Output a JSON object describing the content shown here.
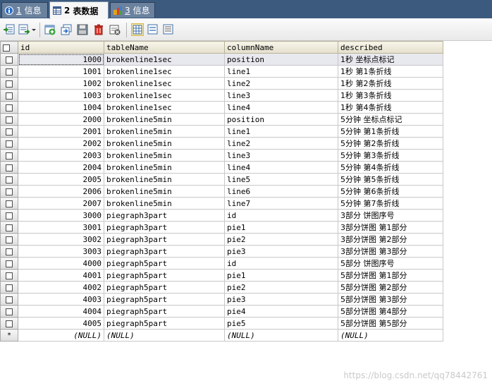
{
  "tabs": [
    {
      "num": "1",
      "label": "信息",
      "active": false,
      "icon": "info-icon"
    },
    {
      "num": "2",
      "label": "表数据",
      "active": true,
      "icon": "table-icon"
    },
    {
      "num": "3",
      "label": "信息",
      "active": false,
      "icon": "info-grid-icon"
    }
  ],
  "toolbar": {
    "items": [
      "export-icon",
      "import-dropdown-icon",
      "insert-row-icon",
      "duplicate-row-icon",
      "save-icon",
      "delete-icon",
      "refresh-icon",
      "grid-view-icon",
      "form-view-icon",
      "text-view-icon"
    ]
  },
  "grid": {
    "columns": [
      "id",
      "tableName",
      "columnName",
      "described"
    ],
    "null_label": "(NULL)",
    "new_row_marker": "*",
    "rows": [
      [
        "1000",
        "brokenline1sec",
        "position",
        "1秒 坐标点标记"
      ],
      [
        "1001",
        "brokenline1sec",
        "line1",
        "1秒 第1条折线"
      ],
      [
        "1002",
        "brokenline1sec",
        "line2",
        "1秒 第2条折线"
      ],
      [
        "1003",
        "brokenline1sec",
        "line3",
        "1秒 第3条折线"
      ],
      [
        "1004",
        "brokenline1sec",
        "line4",
        "1秒 第4条折线"
      ],
      [
        "2000",
        "brokenline5min",
        "position",
        "5分钟 坐标点标记"
      ],
      [
        "2001",
        "brokenline5min",
        "line1",
        "5分钟 第1条折线"
      ],
      [
        "2002",
        "brokenline5min",
        "line2",
        "5分钟 第2条折线"
      ],
      [
        "2003",
        "brokenline5min",
        "line3",
        "5分钟 第3条折线"
      ],
      [
        "2004",
        "brokenline5min",
        "line4",
        "5分钟 第4条折线"
      ],
      [
        "2005",
        "brokenline5min",
        "line5",
        "5分钟 第5条折线"
      ],
      [
        "2006",
        "brokenline5min",
        "line6",
        "5分钟 第6条折线"
      ],
      [
        "2007",
        "brokenline5min",
        "line7",
        "5分钟 第7条折线"
      ],
      [
        "3000",
        "piegraph3part",
        "id",
        "3部分 饼图序号"
      ],
      [
        "3001",
        "piegraph3part",
        "pie1",
        "3部分饼图 第1部分"
      ],
      [
        "3002",
        "piegraph3part",
        "pie2",
        "3部分饼图 第2部分"
      ],
      [
        "3003",
        "piegraph3part",
        "pie3",
        "3部分饼图 第3部分"
      ],
      [
        "4000",
        "piegraph5part",
        "id",
        "5部分 饼图序号"
      ],
      [
        "4001",
        "piegraph5part",
        "pie1",
        "5部分饼图 第1部分"
      ],
      [
        "4002",
        "piegraph5part",
        "pie2",
        "5部分饼图 第2部分"
      ],
      [
        "4003",
        "piegraph5part",
        "pie3",
        "5部分饼图 第3部分"
      ],
      [
        "4004",
        "piegraph5part",
        "pie4",
        "5部分饼图 第4部分"
      ],
      [
        "4005",
        "piegraph5part",
        "pie5",
        "5部分饼图 第5部分"
      ]
    ]
  },
  "watermark": "https://blog.csdn.net/qq78442761",
  "colors": {
    "tabbar": "#3c5a7e",
    "header": "#e4dfcc",
    "selected_row": "#e8e8ef"
  }
}
